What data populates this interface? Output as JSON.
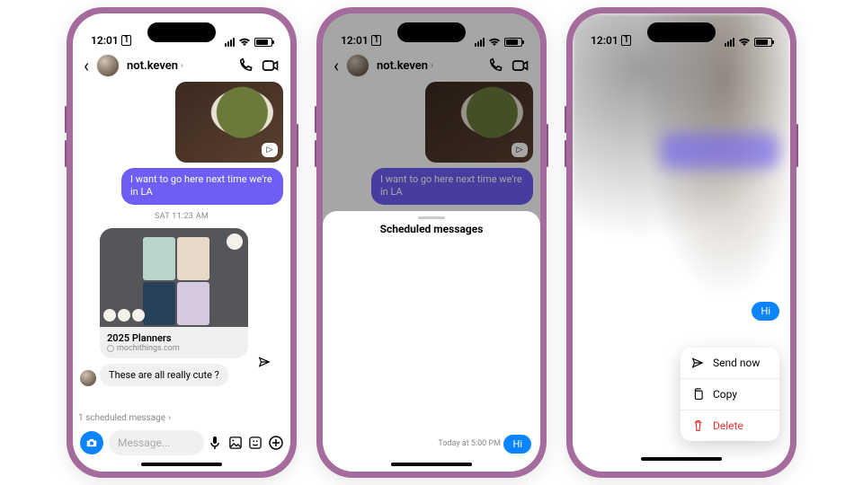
{
  "status": {
    "time": "12:01",
    "sim": "1"
  },
  "chat": {
    "username": "not.keven",
    "timestamp": "SAT 11:23 AM",
    "outgoing": "I want to go here next time we're in LA",
    "card": {
      "title": "2025 Planners",
      "source": "mochithings.com"
    },
    "incoming": "These are all really cute ?",
    "scheduled_banner": "1 scheduled message",
    "input_placeholder": "Message..."
  },
  "sheet": {
    "title": "Scheduled messages",
    "when": "Today at 5:00 PM",
    "bubble": "Hi"
  },
  "ctx": {
    "bubble": "Hi",
    "send": "Send now",
    "copy": "Copy",
    "delete": "Delete"
  }
}
